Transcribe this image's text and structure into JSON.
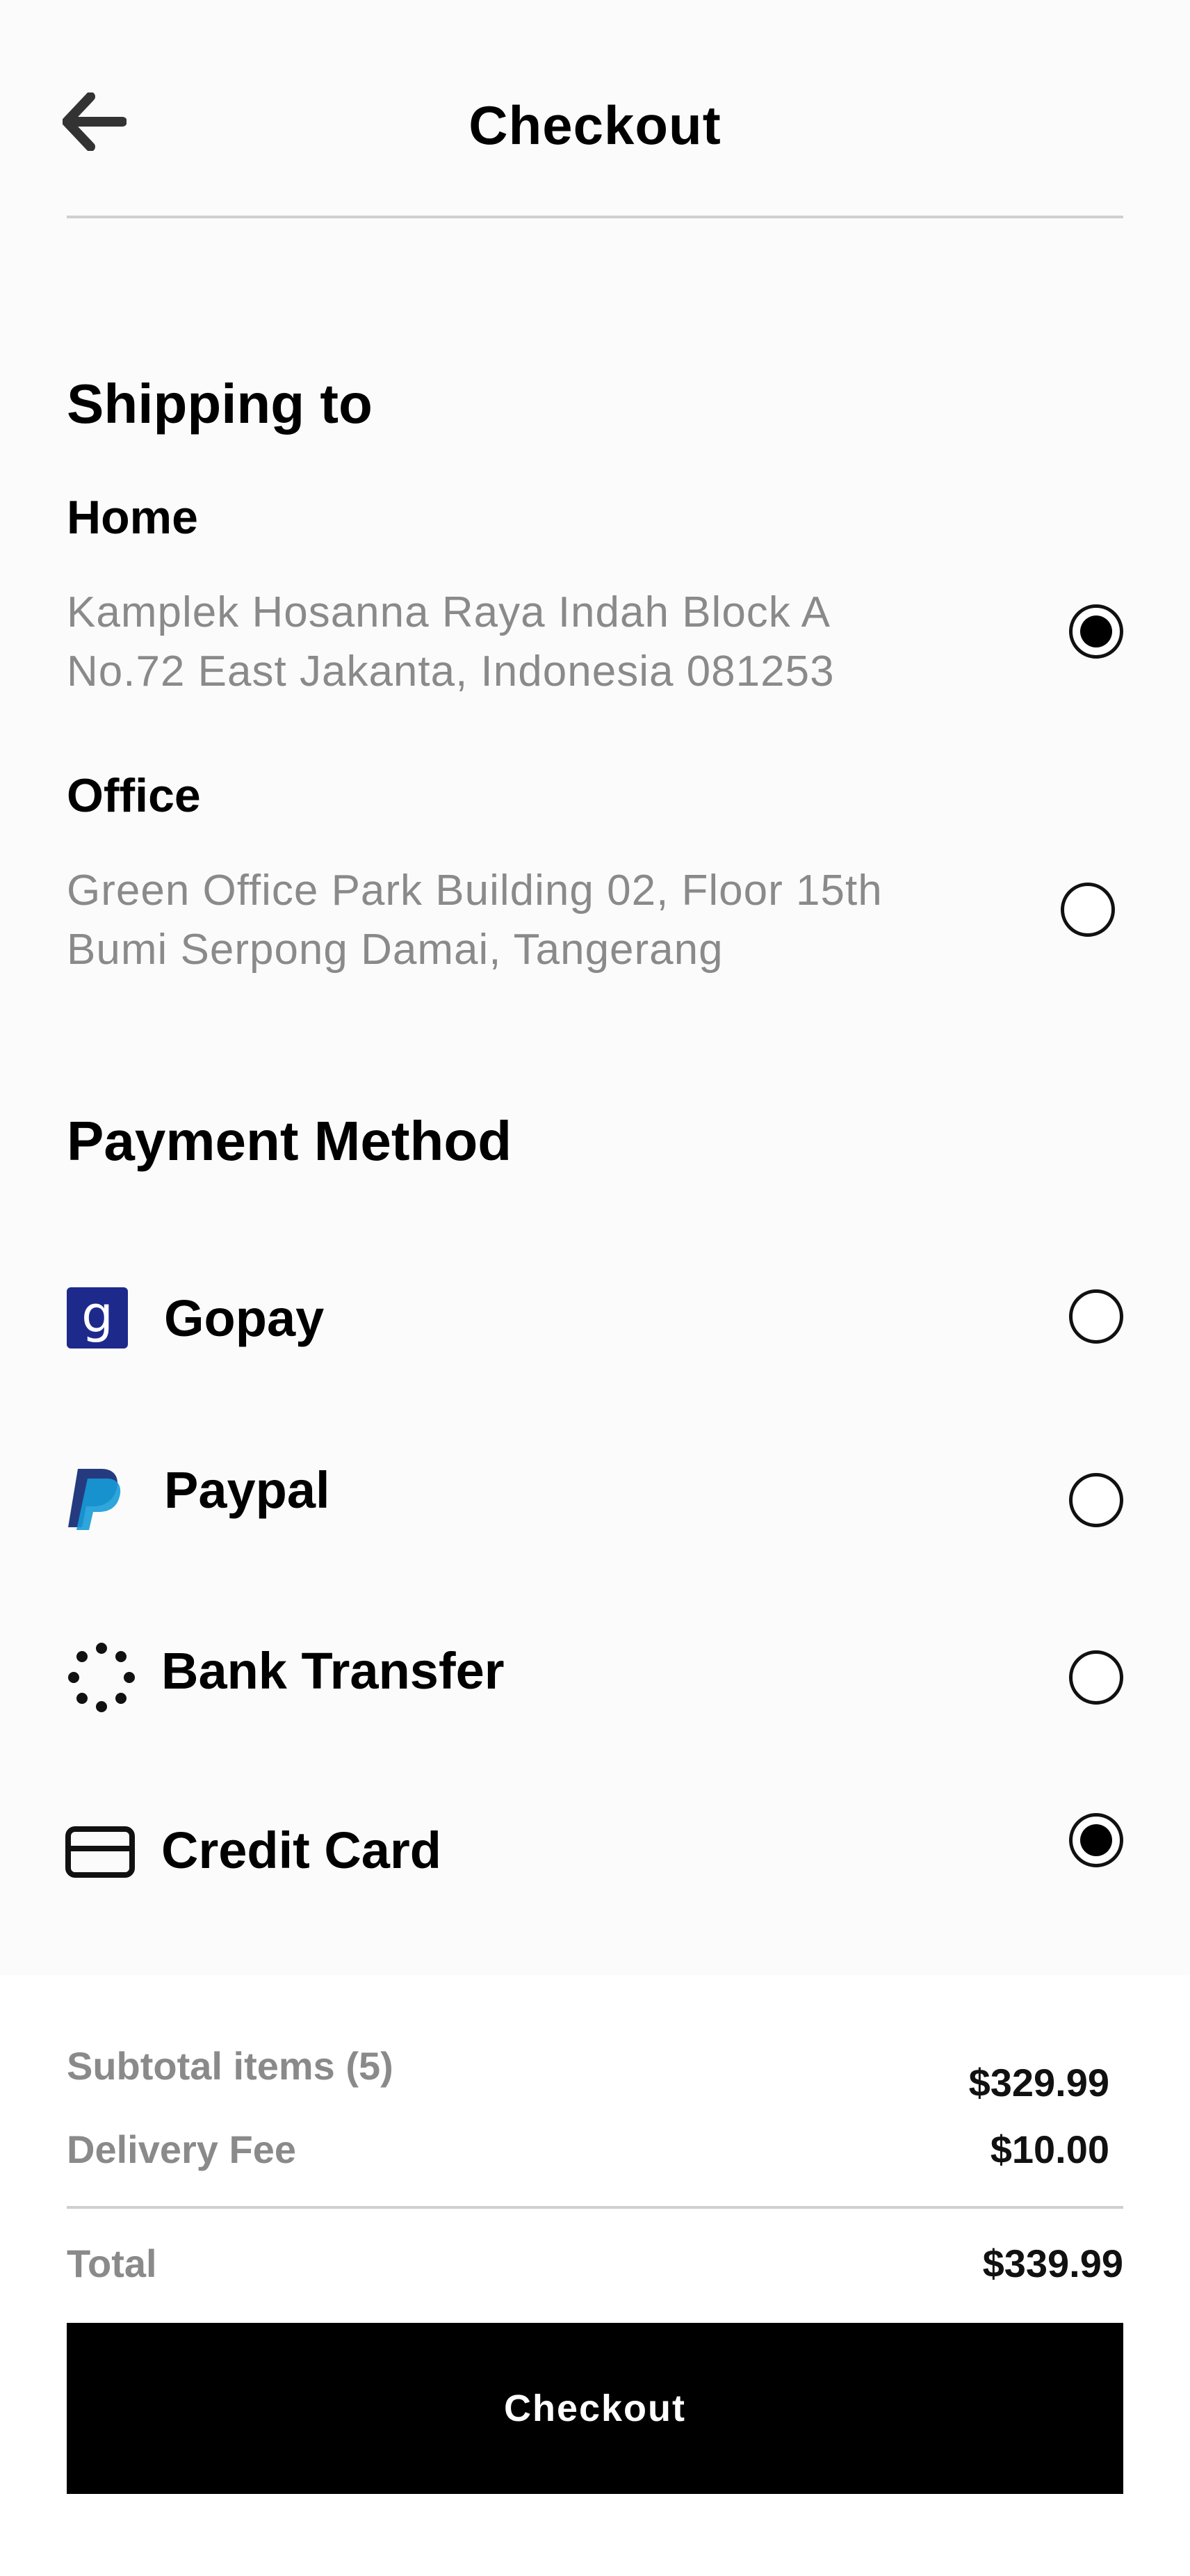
{
  "header": {
    "title": "Checkout",
    "back_icon": "arrow-left-icon"
  },
  "shipping": {
    "title": "Shipping to",
    "addresses": [
      {
        "name": "Home",
        "line1": "Kamplek Hosanna Raya Indah Block A",
        "line2": "No.72 East Jakanta, Indonesia 081253",
        "selected": true
      },
      {
        "name": "Office",
        "line1": "Green Office Park Building 02, Floor 15th",
        "line2": "Bumi Serpong Damai, Tangerang",
        "selected": false
      }
    ]
  },
  "payment": {
    "title": "Payment Method",
    "methods": [
      {
        "label": "Gopay",
        "icon": "gopay-icon",
        "selected": false
      },
      {
        "label": "Paypal",
        "icon": "paypal-icon",
        "selected": false
      },
      {
        "label": "Bank Transfer",
        "icon": "bank-transfer-icon",
        "selected": false
      },
      {
        "label": "Credit Card",
        "icon": "credit-card-icon",
        "selected": true
      }
    ]
  },
  "summary": {
    "subtotal_label": "Subtotal items (5)",
    "subtotal_value": "$329.99",
    "delivery_label": "Delivery Fee",
    "delivery_value": "$10.00",
    "total_label": "Total",
    "total_value": "$339.99"
  },
  "checkout_button": "Checkout",
  "colors": {
    "gopay_brand": "#1d2a8c",
    "paypal_dark": "#253b80",
    "paypal_light": "#179bd7",
    "muted_text": "#8a8a8a",
    "button_bg": "#000000"
  }
}
